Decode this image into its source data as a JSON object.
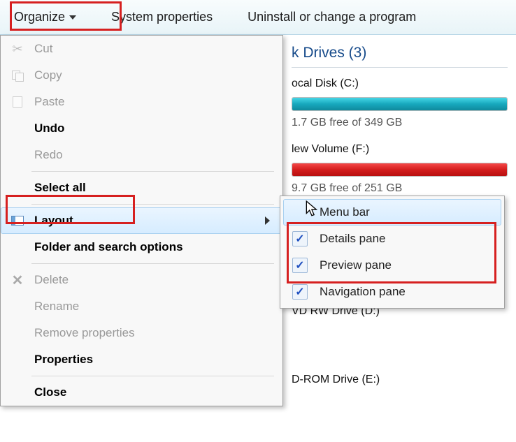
{
  "toolbar": {
    "organize": "Organize",
    "system_properties": "System properties",
    "uninstall": "Uninstall or change a program"
  },
  "menu": {
    "cut": "Cut",
    "copy": "Copy",
    "paste": "Paste",
    "undo": "Undo",
    "redo": "Redo",
    "select_all": "Select all",
    "layout": "Layout",
    "folder_options": "Folder and search options",
    "delete": "Delete",
    "rename": "Rename",
    "remove_properties": "Remove properties",
    "properties": "Properties",
    "close": "Close"
  },
  "submenu": {
    "menu_bar": "Menu bar",
    "details_pane": "Details pane",
    "preview_pane": "Preview pane",
    "navigation_pane": "Navigation pane"
  },
  "content": {
    "drives_header": "k Drives (3)",
    "drive_c_label": "ocal Disk (C:)",
    "drive_c_free": "1.7 GB free of 349 GB",
    "drive_f_label": "lew Volume (F:)",
    "drive_f_free": "9.7 GB free of 251 GB",
    "drive_d": "VD RW Drive (D:)",
    "drive_e": "D-ROM Drive (E:)"
  }
}
